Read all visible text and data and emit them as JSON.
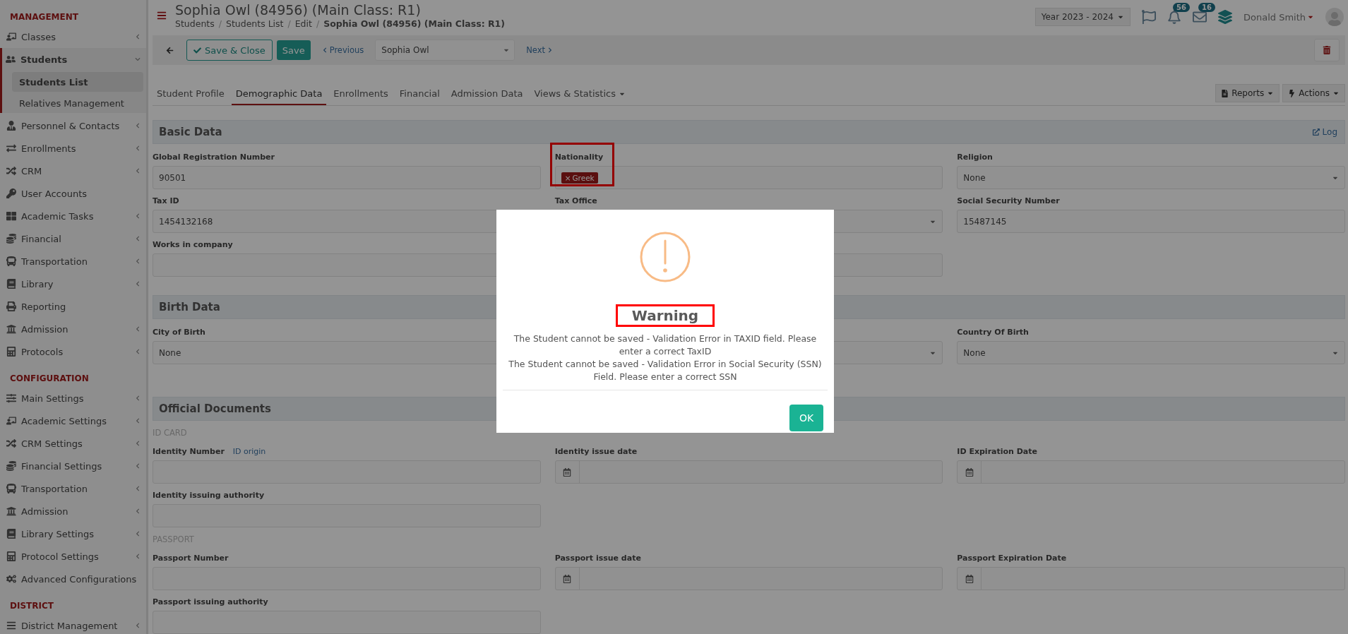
{
  "sidebar": {
    "sections": [
      {
        "title": "MANAGEMENT",
        "items": [
          {
            "label": "Classes",
            "kind": "group",
            "expanded": false
          },
          {
            "label": "Students",
            "kind": "group",
            "expanded": true,
            "children": [
              {
                "label": "Students List",
                "selected": true
              },
              {
                "label": "Relatives Management",
                "selected": false
              }
            ]
          },
          {
            "label": "Personnel & Contacts",
            "kind": "group",
            "expanded": false
          },
          {
            "label": "Enrollments",
            "kind": "group",
            "expanded": false
          },
          {
            "label": "CRM",
            "kind": "group",
            "expanded": false
          },
          {
            "label": "User Accounts",
            "kind": "link"
          },
          {
            "label": "Academic Tasks",
            "kind": "group",
            "expanded": false
          },
          {
            "label": "Financial",
            "kind": "group",
            "expanded": false
          },
          {
            "label": "Transportation",
            "kind": "group",
            "expanded": false
          },
          {
            "label": "Library",
            "kind": "group",
            "expanded": false
          },
          {
            "label": "Reporting",
            "kind": "link"
          },
          {
            "label": "Admission",
            "kind": "group",
            "expanded": false
          },
          {
            "label": "Protocols",
            "kind": "group",
            "expanded": false
          }
        ]
      },
      {
        "title": "CONFIGURATION",
        "items": [
          {
            "label": "Main Settings",
            "kind": "group",
            "expanded": false
          },
          {
            "label": "Academic Settings",
            "kind": "group",
            "expanded": false
          },
          {
            "label": "CRM Settings",
            "kind": "group",
            "expanded": false
          },
          {
            "label": "Financial Settings",
            "kind": "group",
            "expanded": false
          },
          {
            "label": "Transportation",
            "kind": "group",
            "expanded": false
          },
          {
            "label": "Admission",
            "kind": "group",
            "expanded": false
          },
          {
            "label": "Library Settings",
            "kind": "group",
            "expanded": false
          },
          {
            "label": "Protocol Settings",
            "kind": "group",
            "expanded": false
          },
          {
            "label": "Advanced Configurations",
            "kind": "link"
          }
        ]
      },
      {
        "title": "DISTRICT",
        "items": [
          {
            "label": "District Management",
            "kind": "group",
            "expanded": false
          }
        ]
      }
    ]
  },
  "header": {
    "title": "Sophia Owl (84956) (Main Class: R1)",
    "breadcrumbs": [
      "Students",
      "Students List",
      "Edit",
      "Sophia Owl (84956) (Main Class: R1)"
    ],
    "breadcrumb_separator": "/",
    "year": "Year 2023 - 2024",
    "notifications": [
      {
        "kind": "bell",
        "count": "56"
      },
      {
        "kind": "mail",
        "count": "16"
      }
    ],
    "user": "Donald Smith"
  },
  "toolbar": {
    "save_close": "Save & Close",
    "save": "Save",
    "previous": "Previous",
    "student": "Sophia Owl",
    "next": "Next"
  },
  "tabs": [
    {
      "label": "Student Profile",
      "selected": false,
      "dropdown": false
    },
    {
      "label": "Demographic Data",
      "selected": true,
      "dropdown": false
    },
    {
      "label": "Enrollments",
      "selected": false,
      "dropdown": false
    },
    {
      "label": "Financial",
      "selected": false,
      "dropdown": false
    },
    {
      "label": "Admission Data",
      "selected": false,
      "dropdown": false
    },
    {
      "label": "Views & Statistics",
      "selected": false,
      "dropdown": true
    }
  ],
  "tab_actions": [
    "Reports",
    "Actions"
  ],
  "form": {
    "sections": [
      {
        "title": "Basic Data",
        "link": "Log",
        "groups": [
          {
            "fields": [
              {
                "kind": "text",
                "label": "Global Registration Number",
                "value": "90501"
              },
              {
                "kind": "tags",
                "label": "Nationality",
                "tags": [
                  {
                    "label": "Greek",
                    "remove": "×"
                  }
                ],
                "highlighted": true
              },
              {
                "kind": "select",
                "label": "Religion",
                "value": "None"
              },
              {
                "kind": "text",
                "label": "Tax ID",
                "value": "1454132168"
              },
              {
                "kind": "select",
                "label": "Tax Office"
              },
              {
                "kind": "text",
                "label": "Social Security Number",
                "value": "15487145"
              },
              {
                "kind": "text",
                "label": "Works in company"
              },
              {
                "kind": "text"
              }
            ]
          }
        ]
      },
      {
        "title": "Birth Data",
        "groups": [
          {
            "fields": [
              {
                "kind": "select",
                "label": "City of Birth",
                "value": "None"
              },
              {
                "kind": "select"
              },
              {
                "kind": "select",
                "label": "Country Of Birth",
                "value": "None"
              }
            ]
          }
        ]
      },
      {
        "title": "Official Documents",
        "groups": [
          {
            "title": "ID CARD",
            "fields": [
              {
                "kind": "text",
                "label": "Identity Number",
                "link": "ID origin"
              },
              {
                "kind": "date",
                "label": "Identity issue date"
              },
              {
                "kind": "date",
                "label": "ID Expiration Date"
              },
              {
                "kind": "text",
                "label": "Identity issuing authority"
              }
            ]
          },
          {
            "title": "PASSPORT",
            "fields": [
              {
                "kind": "text",
                "label": "Passport Number"
              },
              {
                "kind": "date",
                "label": "Passport issue date"
              },
              {
                "kind": "date",
                "label": "Passport Expiration Date"
              },
              {
                "kind": "text",
                "label": "Passport issuing authority"
              }
            ]
          }
        ]
      }
    ]
  },
  "modal": {
    "kind": "warning",
    "title": "Warning",
    "title_highlighted": true,
    "messages": [
      "The Student cannot be saved - Validation Error in TAXID field. Please enter a correct TaxID",
      "The Student cannot be saved - Validation Error in Social Security (SSN) Field. Please enter a correct SSN"
    ],
    "button": "OK"
  }
}
